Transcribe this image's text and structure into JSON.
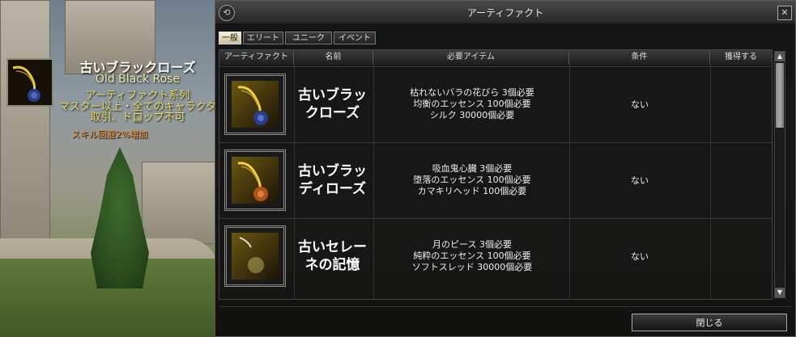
{
  "tooltip": {
    "name": "古いブラックローズ",
    "english_name": "Old Black Rose",
    "category": "アーティファクト系列",
    "requirement": "マスター以上・全てのキャラクター",
    "trade": "取引、ドロップ不可",
    "skill": "スキル回避2%増加",
    "icon": "black-rose-pendant-icon"
  },
  "window": {
    "title": "アーティファクト",
    "close_symbol": "✕",
    "icon_glyph": "⟲"
  },
  "tabs": [
    {
      "label": "一般",
      "active": true
    },
    {
      "label": "エリート",
      "active": false
    },
    {
      "label": "ユニーク",
      "active": false
    },
    {
      "label": "イベント",
      "active": false
    }
  ],
  "columns": [
    "アーティファクト",
    "名前",
    "必要アイテム",
    "条件",
    "獲得する"
  ],
  "rows": [
    {
      "name_lines": [
        "古いブラッ",
        "クローズ"
      ],
      "items": [
        "枯れないバラの花びら 3個必要",
        "均衡のエッセンス 100個必要",
        "シルク 30000個必要"
      ],
      "condition": "ない",
      "icon": "black-rose-pendant-icon",
      "gem_color": "#2a3c8c"
    },
    {
      "name_lines": [
        "古いブラッ",
        "ディローズ"
      ],
      "items": [
        "吸血鬼心臓 3個必要",
        "堕落のエッセンス 100個必要",
        "カマキリヘッド 100個必要"
      ],
      "condition": "ない",
      "icon": "bloody-rose-pendant-icon",
      "gem_color": "#b0501c"
    },
    {
      "name_lines": [
        "古いセレー",
        "ネの記憶"
      ],
      "items": [
        "月のピース 3個必要",
        "純粋のエッセンス 100個必要",
        "ソフトスレッド 30000個必要"
      ],
      "condition": "ない",
      "icon": "crescent-moon-pendant-icon",
      "gem_color": "#e8e8e0"
    }
  ],
  "scrollbar": {
    "up": "▲",
    "down": "▼"
  },
  "close_button": "閉じる"
}
